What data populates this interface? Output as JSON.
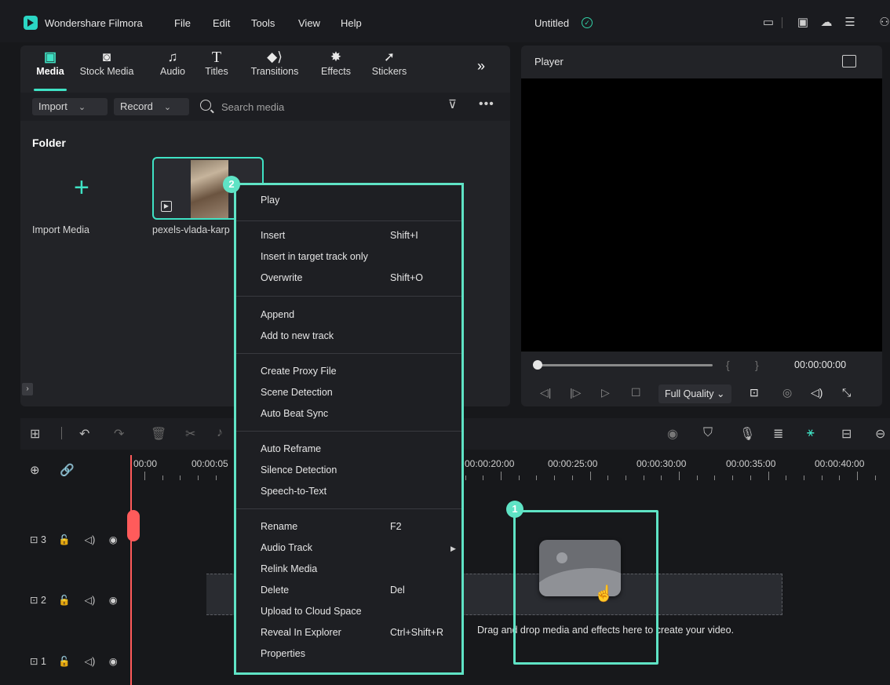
{
  "app": {
    "name": "Wondershare Filmora",
    "menu": [
      "File",
      "Edit",
      "Tools",
      "View",
      "Help"
    ],
    "project_title": "Untitled"
  },
  "media_panel": {
    "tabs": [
      {
        "label": "Media",
        "icon": "media-icon",
        "active": true
      },
      {
        "label": "Stock Media",
        "icon": "stock-media-icon"
      },
      {
        "label": "Audio",
        "icon": "music-note-icon"
      },
      {
        "label": "Titles",
        "icon": "titles-icon"
      },
      {
        "label": "Transitions",
        "icon": "transitions-icon"
      },
      {
        "label": "Effects",
        "icon": "effects-icon"
      },
      {
        "label": "Stickers",
        "icon": "stickers-icon"
      }
    ],
    "import_label": "Import",
    "record_label": "Record",
    "search_placeholder": "Search media",
    "folder_title": "Folder",
    "import_media_label": "Import Media",
    "clip_name": "pexels-vlada-karp"
  },
  "player": {
    "title": "Player",
    "timecode": "00:00:00:00",
    "quality": "Full Quality"
  },
  "timeline": {
    "ruler": [
      "00:00",
      "00:00:05",
      "00:00:20:00",
      "00:00:25:00",
      "00:00:30:00",
      "00:00:35:00",
      "00:00:40:00"
    ],
    "tracks": [
      {
        "label": "3"
      },
      {
        "label": "2"
      },
      {
        "label": "1"
      }
    ],
    "drop_text": "Drag and drop media and effects here to create your video."
  },
  "context_menu": {
    "items": [
      {
        "label": "Play",
        "shortcut": ""
      },
      {
        "label": "Insert",
        "shortcut": "Shift+I"
      },
      {
        "label": "Insert in target track only",
        "shortcut": ""
      },
      {
        "label": "Overwrite",
        "shortcut": "Shift+O"
      },
      {
        "label": "Append",
        "shortcut": ""
      },
      {
        "label": "Add to new track",
        "shortcut": ""
      },
      {
        "label": "Create Proxy File",
        "shortcut": ""
      },
      {
        "label": "Scene Detection",
        "shortcut": ""
      },
      {
        "label": "Auto Beat Sync",
        "shortcut": ""
      },
      {
        "label": "Auto Reframe",
        "shortcut": ""
      },
      {
        "label": "Silence Detection",
        "shortcut": ""
      },
      {
        "label": "Speech-to-Text",
        "shortcut": ""
      },
      {
        "label": "Rename",
        "shortcut": "F2"
      },
      {
        "label": "Audio Track",
        "shortcut": ""
      },
      {
        "label": "Relink Media",
        "shortcut": ""
      },
      {
        "label": "Delete",
        "shortcut": "Del"
      },
      {
        "label": "Upload to Cloud Space",
        "shortcut": ""
      },
      {
        "label": "Reveal In Explorer",
        "shortcut": "Ctrl+Shift+R"
      },
      {
        "label": "Properties",
        "shortcut": ""
      }
    ]
  },
  "annotations": {
    "badge_1": "1",
    "badge_2": "2"
  },
  "colors": {
    "accent": "#3fe2c4",
    "highlight": "#5fe3c5",
    "playhead": "#ff5b5b"
  }
}
